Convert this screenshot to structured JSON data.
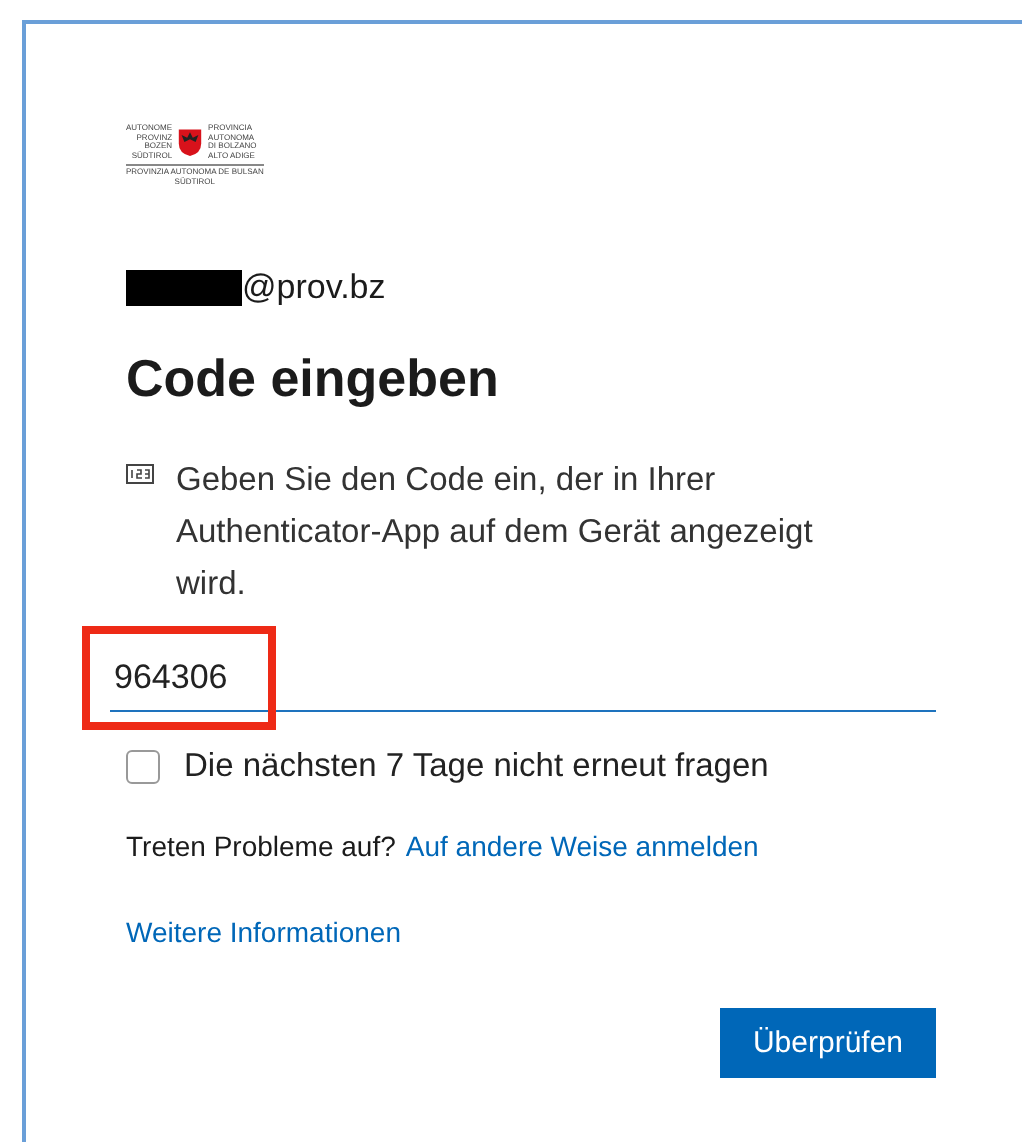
{
  "logo": {
    "left_lines": [
      "AUTONOME",
      "PROVINZ",
      "BOZEN",
      "SÜDTIROL"
    ],
    "right_lines": [
      "PROVINCIA",
      "AUTONOMA",
      "DI BOLZANO",
      "ALTO ADIGE"
    ],
    "bottom_lines": [
      "PROVINZIA AUTONOMA DE BULSAN",
      "SÜDTIROL"
    ]
  },
  "account": {
    "redacted": true,
    "domain": "@prov.bz"
  },
  "title": "Code eingeben",
  "instruction": "Geben Sie den Code ein, der in Ihrer Authenticator-App auf dem Gerät angezeigt wird.",
  "code_field": {
    "value": "964306",
    "highlighted": true
  },
  "remember": {
    "label": "Die nächsten 7 Tage nicht erneut fragen",
    "checked": false
  },
  "trouble": {
    "text": "Treten Probleme auf?",
    "link": "Auf andere Weise anmelden"
  },
  "more_info": "Weitere Informationen",
  "submit": "Überprüfen"
}
